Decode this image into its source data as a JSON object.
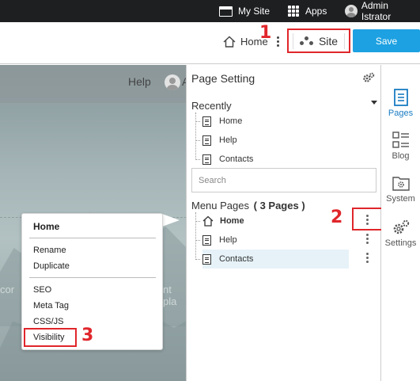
{
  "topbar": {
    "my_site": "My Site",
    "apps": "Apps",
    "user": "Admin Istrator"
  },
  "header": {
    "home": "Home",
    "site": "Site",
    "save": "Save"
  },
  "steps": {
    "one": "1",
    "two": "2",
    "three": "3"
  },
  "preview": {
    "help": "Help",
    "user_initial": "A",
    "faded_left": "cor",
    "faded_right": "nt pla"
  },
  "context_menu": {
    "home": "Home",
    "rename": "Rename",
    "duplicate": "Duplicate",
    "seo": "SEO",
    "meta_tag": "Meta Tag",
    "css_js": "CSS/JS",
    "visibility": "Visibility"
  },
  "panel": {
    "title": "Page Setting",
    "recently_label": "Recently",
    "recently": [
      "Home",
      "Help",
      "Contacts"
    ],
    "search_placeholder": "Search",
    "menu_pages_label": "Menu Pages",
    "menu_pages_count": "( 3 Pages )",
    "menu_pages": [
      "Home",
      "Help",
      "Contacts"
    ]
  },
  "sidebar": {
    "pages": "Pages",
    "blog": "Blog",
    "system": "System",
    "settings": "Settings"
  },
  "colors": {
    "accent_blue": "#1da1e2",
    "highlight_red": "#e0262b",
    "topbar": "#1e1f21"
  }
}
